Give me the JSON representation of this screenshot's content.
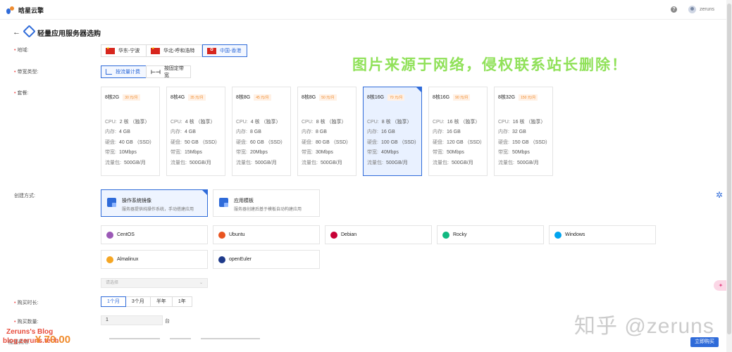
{
  "header": {
    "brand": "晗星云擎",
    "help_icon": "question-circle-icon",
    "username": "zeruns"
  },
  "page": {
    "title": "轻量应用服务器选购"
  },
  "labels": {
    "region": "地域:",
    "bandwidth_type": "带宽类型:",
    "package": "套餐:",
    "create_method": "创建方式:",
    "duration": "购买时长:",
    "quantity": "购买数量:"
  },
  "regions": [
    {
      "label": "华东-宁波",
      "selected": false
    },
    {
      "label": "华北-呼和浩特",
      "selected": false
    },
    {
      "label": "中国-香港",
      "selected": true
    }
  ],
  "bandwidth_types": [
    {
      "label": "按流量计费",
      "selected": true
    },
    {
      "label": "按固定带宽",
      "selected": false
    }
  ],
  "packages": [
    {
      "name": "8核2G",
      "price": "30 元/月",
      "cpu": "2 核 （独享）",
      "mem": "4 GB",
      "disk": "40 GB （SSD）",
      "bw": "10Mbps",
      "traffic": "500GB/月",
      "selected": false
    },
    {
      "name": "8核4G",
      "price": "35 元/月",
      "cpu": "4 核 （独享）",
      "mem": "4 GB",
      "disk": "50 GB （SSD）",
      "bw": "15Mbps",
      "traffic": "500GB/月",
      "selected": false
    },
    {
      "name": "8核8G",
      "price": "45 元/月",
      "cpu": "4 核 （独享）",
      "mem": "8 GB",
      "disk": "60 GB （SSD）",
      "bw": "20Mbps",
      "traffic": "500GB/月",
      "selected": false
    },
    {
      "name": "8核8G",
      "price": "50 元/月",
      "cpu": "8 核 （独享）",
      "mem": "8 GB",
      "disk": "80 GB （SSD）",
      "bw": "30Mbps",
      "traffic": "500GB/月",
      "selected": false
    },
    {
      "name": "8核16G",
      "price": "70 元/月",
      "cpu": "8 核 （独享）",
      "mem": "16 GB",
      "disk": "100 GB （SSD）",
      "bw": "40Mbps",
      "traffic": "500GB/月",
      "selected": true
    },
    {
      "name": "8核16G",
      "price": "90 元/月",
      "cpu": "16 核 （独享）",
      "mem": "16 GB",
      "disk": "120 GB （SSD）",
      "bw": "50Mbps",
      "traffic": "500GB/月",
      "selected": false
    },
    {
      "name": "8核32G",
      "price": "150 元/月",
      "cpu": "16 核 （独享）",
      "mem": "32 GB",
      "disk": "150 GB （SSD）",
      "bw": "50Mbps",
      "traffic": "500GB/月",
      "selected": false
    }
  ],
  "spec_labels": {
    "cpu": "CPU:",
    "mem": "内存:",
    "disk": "硬盘:",
    "bw": "带宽:",
    "traffic": "流量包:"
  },
  "create_methods": [
    {
      "title": "操作系统镜像",
      "desc": "服务器提供纯操作系统，手动搭建应用",
      "selected": true
    },
    {
      "title": "应用模板",
      "desc": "服务器创建后基于模板自动构建应用",
      "selected": false
    }
  ],
  "os_images": [
    {
      "label": "CentOS",
      "icon": "centos-icon",
      "color": "#9b59b6"
    },
    {
      "label": "Ubuntu",
      "icon": "ubuntu-icon",
      "color": "#e95420"
    },
    {
      "label": "Debian",
      "icon": "debian-icon",
      "color": "#c70036"
    },
    {
      "label": "Rocky",
      "icon": "rocky-icon",
      "color": "#10b981"
    },
    {
      "label": "Windows",
      "icon": "windows-icon",
      "color": "#00a4ef"
    },
    {
      "label": "Almalinux",
      "icon": "almalinux-icon",
      "color": "#f5a623"
    },
    {
      "label": "openEuler",
      "icon": "openeuler-icon",
      "color": "#1e3a8a"
    }
  ],
  "version_select": {
    "placeholder": "请选择"
  },
  "durations": [
    {
      "label": "1个月",
      "selected": true
    },
    {
      "label": "3个月",
      "selected": false
    },
    {
      "label": "半年",
      "selected": false
    },
    {
      "label": "1年",
      "selected": false
    }
  ],
  "quantity": {
    "value": "1",
    "unit": "台"
  },
  "footer": {
    "price_label": "配置费用:",
    "price": "¥ 70.00",
    "buy_label": "立即购买"
  },
  "watermarks": {
    "green": "图片来源于网络，侵权联系站长删除！",
    "zhihu": "知乎 @zeruns",
    "blog_line1": "Zeruns's Blog",
    "blog_line2": "blog.zeruns.tech"
  },
  "colors": {
    "accent": "#2f6bd9",
    "price": "#f08c2e"
  }
}
